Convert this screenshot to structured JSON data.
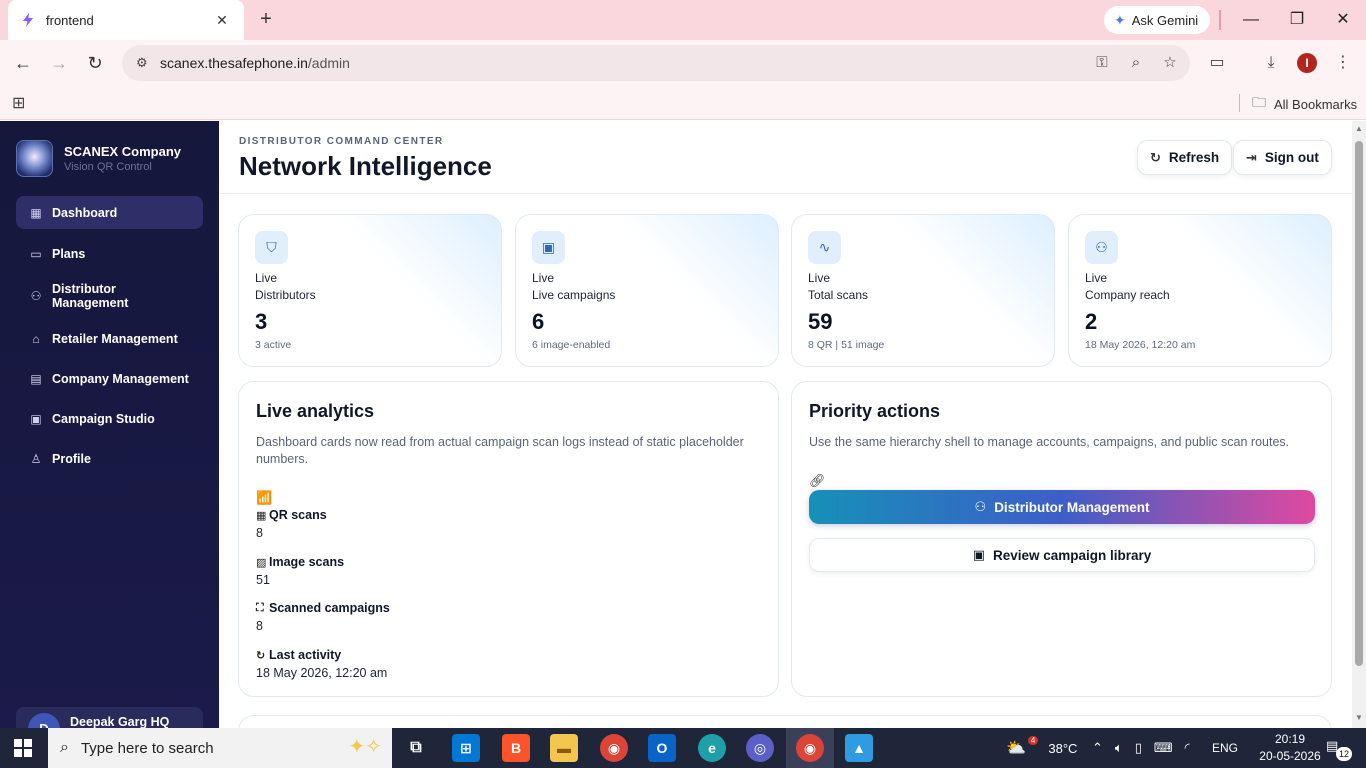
{
  "browser": {
    "tab_title": "frontend",
    "ask_gemini": "Ask Gemini",
    "url_host": "scanex.thesafephone.in",
    "url_path": "/admin",
    "profile_initial": "I",
    "all_bookmarks": "All Bookmarks"
  },
  "sidebar": {
    "brand_name": "SCANEX Company",
    "brand_sub": "Vision QR Control",
    "items": [
      {
        "label": "Dashboard",
        "icon": "dashboard-icon",
        "active": true
      },
      {
        "label": "Plans",
        "icon": "card-icon"
      },
      {
        "label": "Distributor Management",
        "icon": "users-icon"
      },
      {
        "label": "Retailer Management",
        "icon": "store-icon"
      },
      {
        "label": "Company Management",
        "icon": "building-icon"
      },
      {
        "label": "Campaign Studio",
        "icon": "clapper-icon"
      },
      {
        "label": "Profile",
        "icon": "user-icon"
      }
    ],
    "user_initial": "D",
    "user_name": "Deepak Garg HQ"
  },
  "header": {
    "eyebrow": "DISTRIBUTOR COMMAND CENTER",
    "title": "Network Intelligence",
    "refresh_label": "Refresh",
    "signout_label": "Sign out"
  },
  "stats": [
    {
      "live": "Live",
      "label": "Distributors",
      "value": "3",
      "sub": "3 active",
      "icon": "shield-icon"
    },
    {
      "live": "Live",
      "label": "Live campaigns",
      "value": "6",
      "sub": "6 image-enabled",
      "icon": "clapper-icon"
    },
    {
      "live": "Live",
      "label": "Total scans",
      "value": "59",
      "sub": "8 QR | 51 image",
      "icon": "activity-icon"
    },
    {
      "live": "Live",
      "label": "Company reach",
      "value": "2",
      "sub": "18 May 2026, 12:20 am",
      "icon": "users-icon"
    }
  ],
  "analytics": {
    "title": "Live analytics",
    "description": "Dashboard cards now read from actual campaign scan logs instead of static placeholder numbers.",
    "metrics": [
      {
        "label": "QR scans",
        "value": "8",
        "icon": "qr-icon"
      },
      {
        "label": "Image scans",
        "value": "51",
        "icon": "image-icon"
      },
      {
        "label": "Scanned campaigns",
        "value": "8",
        "icon": "scan-icon"
      },
      {
        "label": "Last activity",
        "value": "18 May 2026, 12:20 am",
        "icon": "refresh-icon"
      }
    ]
  },
  "priority": {
    "title": "Priority actions",
    "description": "Use the same hierarchy shell to manage accounts, campaigns, and public scan routes.",
    "primary_label": "Distributor Management",
    "secondary_label": "Review campaign library"
  },
  "taskbar": {
    "search_placeholder": "Type here to search",
    "weather": "38°C",
    "weather_badge": "4",
    "language": "ENG",
    "time": "20:19",
    "date": "20-05-2026",
    "notifications": "12"
  },
  "colors": {
    "sidebar_bg": "#15173b",
    "accent_gradient_start": "#1790b8",
    "accent_gradient_end": "#e049a0",
    "tab_strip": "#f9d7dc"
  }
}
